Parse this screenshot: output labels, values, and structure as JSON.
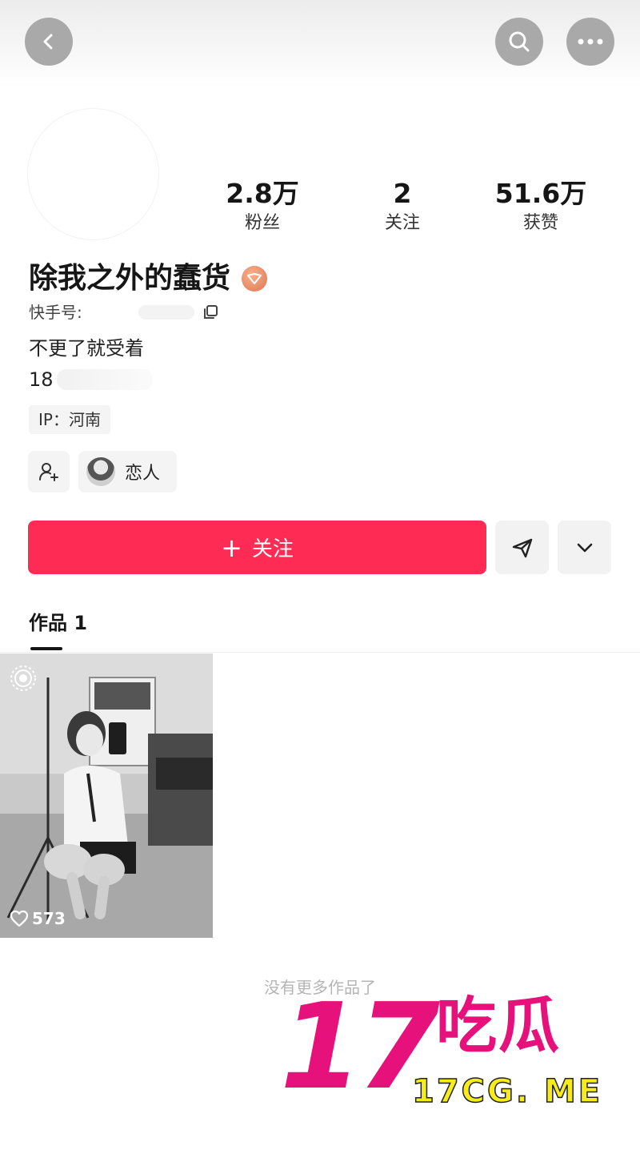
{
  "profile": {
    "stats": [
      {
        "value": "2.8万",
        "label": "粉丝"
      },
      {
        "value": "2",
        "label": "关注"
      },
      {
        "value": "51.6万",
        "label": "获赞"
      }
    ],
    "name": "除我之外的蠢货",
    "kuaishou_id_label": "快手号:",
    "bio_line1": "不更了就受着",
    "bio_line2": "18",
    "ip": "IP：河南",
    "relation_label": "恋人"
  },
  "actions": {
    "follow_label": "关注"
  },
  "works": {
    "tab_label": "作品 1",
    "items": [
      {
        "likes": "573"
      }
    ],
    "end_text": "没有更多作品了"
  },
  "watermark": {
    "number": "17",
    "chinese": "吃瓜",
    "url": "17CG. ME"
  },
  "colors": {
    "accent": "#fe2c55",
    "watermark_pink": "#e6117a",
    "watermark_yellow": "#f6ec1c"
  },
  "icons": [
    "back-icon",
    "search-icon",
    "more-icon",
    "verified-badge-icon",
    "copy-icon",
    "add-friend-icon",
    "send-icon",
    "chevron-down-icon",
    "heart-icon",
    "live-icon"
  ]
}
